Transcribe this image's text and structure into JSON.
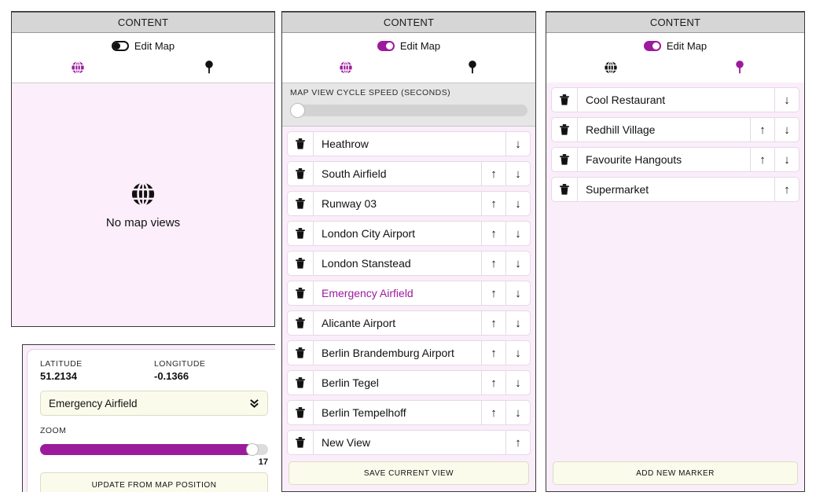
{
  "panels": [
    {
      "id": "map-views-empty",
      "header": "CONTENT",
      "toggle": {
        "label": "Edit Map",
        "state": "off"
      },
      "tabs": [
        {
          "icon": "globe-icon",
          "name": "map-views-tab",
          "active": true
        },
        {
          "icon": "map-pin-icon",
          "name": "markers-tab",
          "active": false
        }
      ],
      "empty_state": {
        "icon": "globe-icon",
        "text": "No map views"
      },
      "card": {
        "latitude_label": "LATITUDE",
        "latitude_value": "51.2134",
        "longitude_label": "LONGITUDE",
        "longitude_value": "-0.1366",
        "select_value": "Emergency Airfield",
        "select_icon": "chevron-double-down-icon",
        "zoom_label": "ZOOM",
        "zoom_value": "17",
        "zoom_percent": 93,
        "update_button": "UPDATE FROM MAP POSITION"
      }
    },
    {
      "id": "map-views-list",
      "header": "CONTENT",
      "toggle": {
        "label": "Edit Map",
        "state": "on"
      },
      "tabs": [
        {
          "icon": "globe-icon",
          "name": "map-views-tab",
          "active": true
        },
        {
          "icon": "map-pin-icon",
          "name": "markers-tab",
          "active": false
        }
      ],
      "speed": {
        "label": "MAP VIEW CYCLE SPEED (SECONDS)",
        "percent": 0
      },
      "rows": [
        {
          "label": "Heathrow",
          "up": false,
          "down": true,
          "highlight": false
        },
        {
          "label": "South Airfield",
          "up": true,
          "down": true,
          "highlight": false
        },
        {
          "label": "Runway 03",
          "up": true,
          "down": true,
          "highlight": false
        },
        {
          "label": "London City Airport",
          "up": true,
          "down": true,
          "highlight": false
        },
        {
          "label": "London Stanstead",
          "up": true,
          "down": true,
          "highlight": false
        },
        {
          "label": "Emergency Airfield",
          "up": true,
          "down": true,
          "highlight": true
        },
        {
          "label": "Alicante Airport",
          "up": true,
          "down": true,
          "highlight": false
        },
        {
          "label": "Berlin Brandemburg Airport",
          "up": true,
          "down": true,
          "highlight": false
        },
        {
          "label": "Berlin Tegel",
          "up": true,
          "down": true,
          "highlight": false
        },
        {
          "label": "Berlin Tempelhoff",
          "up": true,
          "down": true,
          "highlight": false
        },
        {
          "label": "New View",
          "up": true,
          "down": false,
          "highlight": false
        }
      ],
      "footer_button": "SAVE CURRENT VIEW"
    },
    {
      "id": "markers-list",
      "header": "CONTENT",
      "toggle": {
        "label": "Edit Map",
        "state": "on"
      },
      "tabs": [
        {
          "icon": "globe-icon",
          "name": "map-views-tab",
          "active": false
        },
        {
          "icon": "map-pin-icon",
          "name": "markers-tab",
          "active": true
        }
      ],
      "rows": [
        {
          "label": "Cool Restaurant",
          "up": false,
          "down": true,
          "highlight": false
        },
        {
          "label": "Redhill Village",
          "up": true,
          "down": true,
          "highlight": false
        },
        {
          "label": "Favourite Hangouts",
          "up": true,
          "down": true,
          "highlight": false
        },
        {
          "label": "Supermarket",
          "up": true,
          "down": false,
          "highlight": false
        }
      ],
      "footer_button": "ADD NEW MARKER"
    }
  ],
  "glyphs": {
    "trash": "🗑",
    "arrow_up": "↑",
    "arrow_down": "↓"
  },
  "colors": {
    "accent": "#9c1a9c",
    "panel_bg": "#fbeefb",
    "header_bar": "#d6d6d6",
    "button_bg": "#fbfbec"
  }
}
